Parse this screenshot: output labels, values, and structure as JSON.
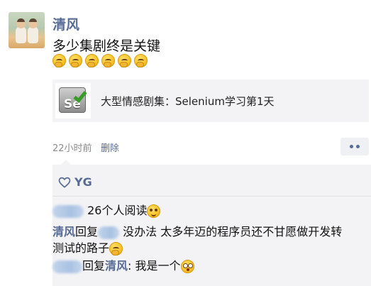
{
  "post": {
    "username": "清风",
    "text": "多少集剧终是关键",
    "emoji_row": [
      "thinking-emoji",
      "thinking-emoji",
      "thinking-emoji",
      "thinking-emoji",
      "thinking-emoji",
      "thinking-emoji"
    ],
    "link": {
      "icon": "selenium-logo",
      "icon_text": "Se",
      "title": "大型情感剧集：Selenium学习第1天"
    },
    "time": "22小时前",
    "delete_label": "删除"
  },
  "likes": {
    "icon": "heart-outline-icon",
    "names": "YG"
  },
  "comments": {
    "read_text": "26个人阅读",
    "reply1_author": "清风",
    "reply1_word": "回复",
    "reply1_text_line1": "没办法 太多年迈的程序员还不甘愿做开发转",
    "reply1_text_line2": "测试的路子",
    "reply2_word": "回复",
    "reply2_target": "清风",
    "reply2_text": ": 我是一个"
  },
  "colors": {
    "link_blue": "#576b95",
    "card_bg": "#f3f3f5"
  }
}
